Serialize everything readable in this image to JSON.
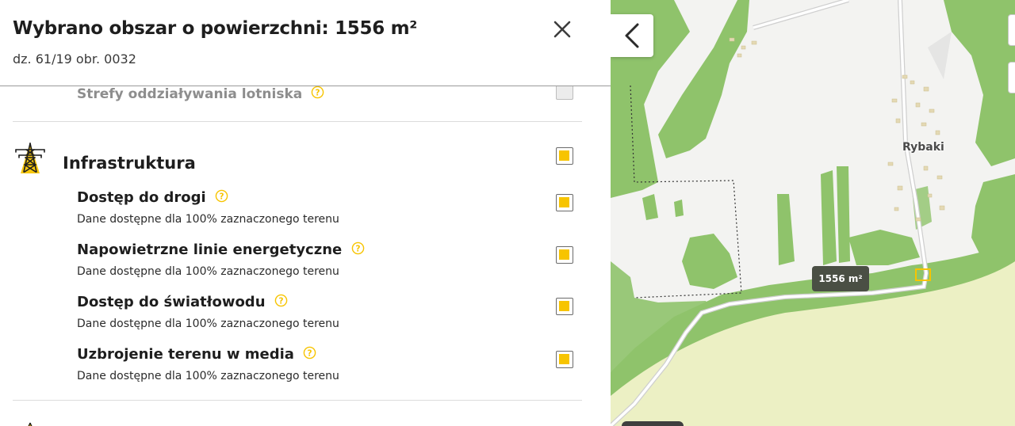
{
  "header": {
    "title": "Wybrano obszar o powierzchni: 1556 m²",
    "subtitle": "dz. 61/19 obr. 0032"
  },
  "faded_item": {
    "label": "Strefy oddziaływania lotniska",
    "checked": false
  },
  "section": {
    "title": "Infrastruktura",
    "icon": "power-tower-icon",
    "checked": true,
    "items": [
      {
        "title": "Dostęp do drogi",
        "desc": "Dane dostępne dla 100% zaznaczonego terenu",
        "checked": true
      },
      {
        "title": "Napowietrzne linie energetyczne",
        "desc": "Dane dostępne dla 100% zaznaczonego terenu",
        "checked": true
      },
      {
        "title": "Dostęp do światłowodu",
        "desc": "Dane dostępne dla 100% zaznaczonego terenu",
        "checked": true
      },
      {
        "title": "Uzbrojenie terenu w media",
        "desc": "Dane dostępne dla 100% zaznaczonego terenu",
        "checked": true
      }
    ]
  },
  "map": {
    "place_label": "Rybaki",
    "area_badge": "1556 m²"
  },
  "colors": {
    "accent": "#f7c400",
    "forest": "#8fc36b",
    "field": "#ecf0c4",
    "badge": "#4a4f44"
  }
}
